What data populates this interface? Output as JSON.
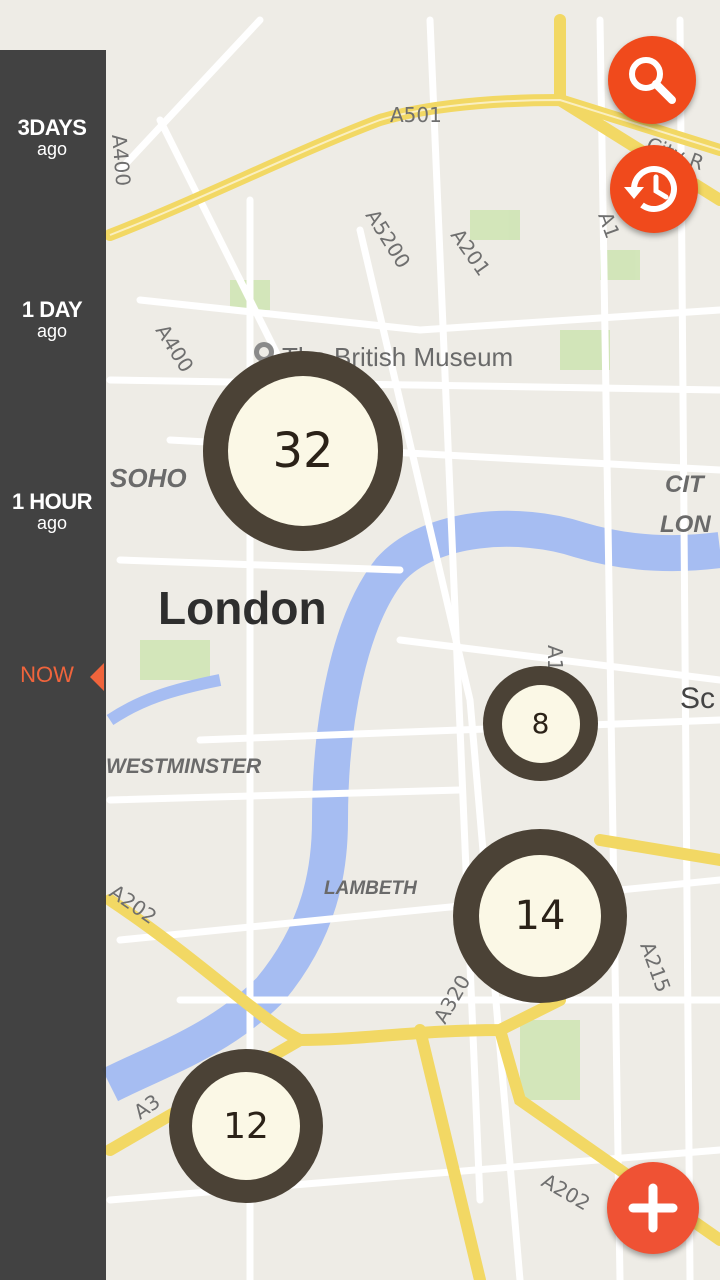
{
  "timeline": {
    "items": [
      {
        "main": "3DAYS",
        "sub": "ago"
      },
      {
        "main": "1 DAY",
        "sub": "ago"
      },
      {
        "main": "1 HOUR",
        "sub": "ago"
      }
    ],
    "now_label": "NOW"
  },
  "map": {
    "city_label": "London",
    "poi_label": "The British Museum",
    "districts": [
      "SOHO",
      "WESTMINSTER",
      "LAMBETH",
      "CIT",
      "LON",
      "Sc"
    ],
    "roads": [
      "A501",
      "A5200",
      "A201",
      "A400",
      "A400",
      "A1",
      "A202",
      "A3",
      "A320",
      "A215",
      "A202",
      "A1",
      "City R"
    ]
  },
  "clusters": [
    {
      "count": "32"
    },
    {
      "count": "8"
    },
    {
      "count": "14"
    },
    {
      "count": "12"
    }
  ],
  "buttons": {
    "search_icon": "search-icon",
    "history_icon": "history-icon",
    "add_icon": "plus-icon"
  },
  "colors": {
    "accent": "#f04a1c",
    "panel": "#373737",
    "cluster_ring": "#4b4236",
    "cluster_fill": "#fbf8e6",
    "water": "#a6bdf2",
    "major_road": "#f6e27e"
  }
}
